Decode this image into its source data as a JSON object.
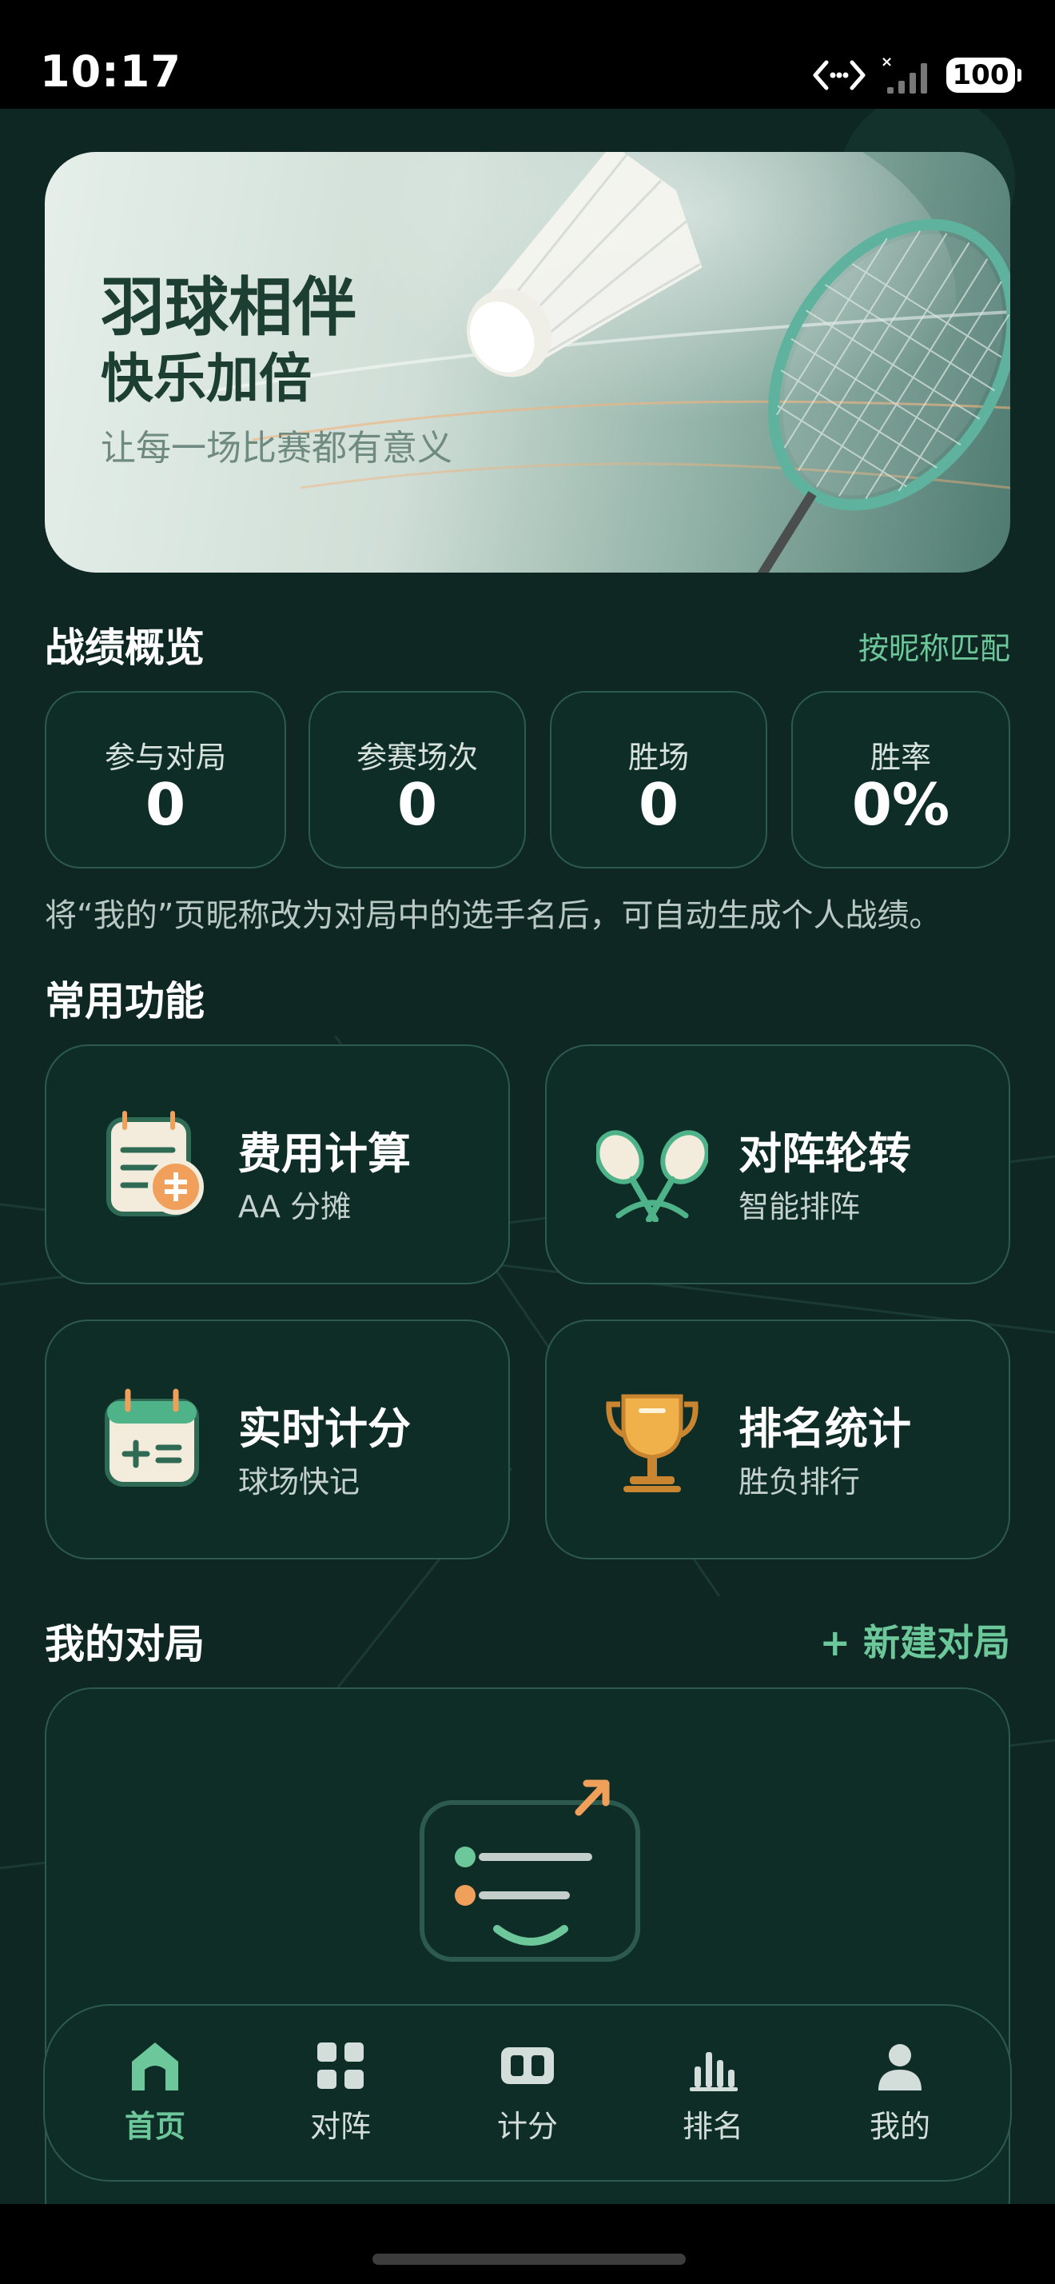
{
  "status": {
    "time": "10:17",
    "battery": "100"
  },
  "hero": {
    "title_line1": "羽球相伴",
    "title_line2": "快乐加倍",
    "subtitle": "让每一场比赛都有意义"
  },
  "stats": {
    "title": "战绩概览",
    "link": "按昵称匹配",
    "items": [
      {
        "label": "参与对局",
        "value": "0"
      },
      {
        "label": "参赛场次",
        "value": "0"
      },
      {
        "label": "胜场",
        "value": "0"
      },
      {
        "label": "胜率",
        "value": "0%"
      }
    ],
    "hint": "将“我的”页昵称改为对局中的选手名后，可自动生成个人战绩。"
  },
  "features": {
    "title": "常用功能",
    "items": [
      {
        "title": "费用计算",
        "subtitle": "AA 分摊",
        "icon": "expense-calculator-icon"
      },
      {
        "title": "对阵轮转",
        "subtitle": "智能排阵",
        "icon": "crossed-rackets-icon"
      },
      {
        "title": "实时计分",
        "subtitle": "球场快记",
        "icon": "score-calendar-icon"
      },
      {
        "title": "排名统计",
        "subtitle": "胜负排行",
        "icon": "trophy-icon"
      }
    ]
  },
  "matches": {
    "title": "我的对局",
    "new_label": "+ 新建对局"
  },
  "tabs": [
    {
      "label": "首页",
      "icon": "home-icon",
      "active": true
    },
    {
      "label": "对阵",
      "icon": "grid-icon",
      "active": false
    },
    {
      "label": "计分",
      "icon": "scoreboard-icon",
      "active": false
    },
    {
      "label": "排名",
      "icon": "bar-chart-icon",
      "active": false
    },
    {
      "label": "我的",
      "icon": "user-icon",
      "active": false
    }
  ],
  "colors": {
    "background": "#0e2722",
    "card": "#0f2d27",
    "card_border": "#2d5a4e",
    "accent": "#6cc79a",
    "orange": "#f0a05a"
  }
}
